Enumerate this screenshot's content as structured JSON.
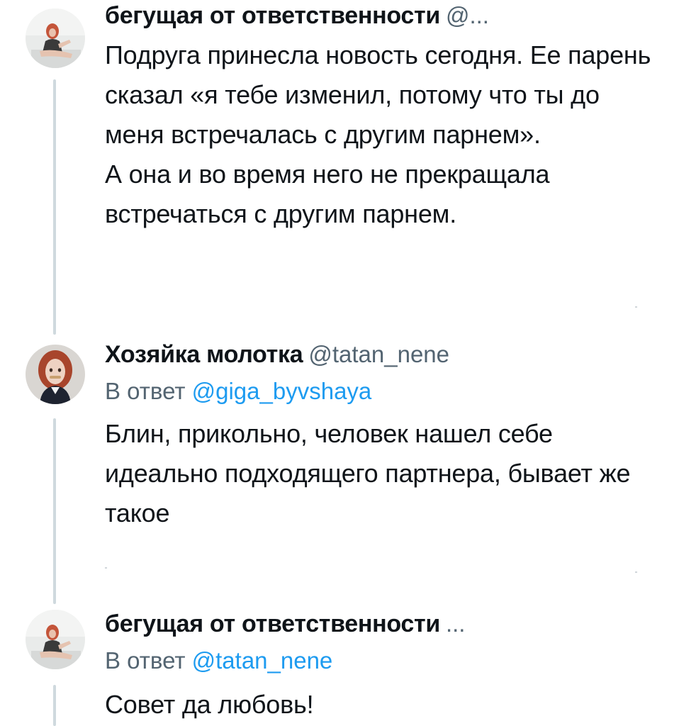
{
  "tweets": [
    {
      "author_name": "бегущая от ответственности",
      "author_handle": "@...",
      "reply_prefix": "",
      "reply_to": "",
      "lines": [
        "Подруга принесла новость сегодня. Ее парень сказал «я тебе изменил, потому что ты до меня встречалась с другим парнем».",
        "А она и во время него не прекращала встречаться с другим парнем."
      ],
      "avatar": "avatar-red-hair-woman-sitting"
    },
    {
      "author_name": "Хозяйка молотка",
      "author_handle": "@tatan_nene",
      "reply_prefix": "В ответ ",
      "reply_to": "@giga_byvshaya",
      "lines": [
        "Блин, прикольно, человек нашел себе идеально подходящего партнера, бывает же такое"
      ],
      "avatar": "avatar-red-hair-woman-portrait"
    },
    {
      "author_name": "бегущая от ответственности",
      "author_handle": "...",
      "reply_prefix": "В ответ ",
      "reply_to": "@tatan_nene",
      "lines": [
        "Совет да любовь!"
      ],
      "avatar": "avatar-red-hair-woman-sitting"
    }
  ],
  "colors": {
    "text": "#0f1419",
    "secondary": "#536471",
    "mention": "#1d9bf0",
    "thread_line": "#cfd9de"
  }
}
